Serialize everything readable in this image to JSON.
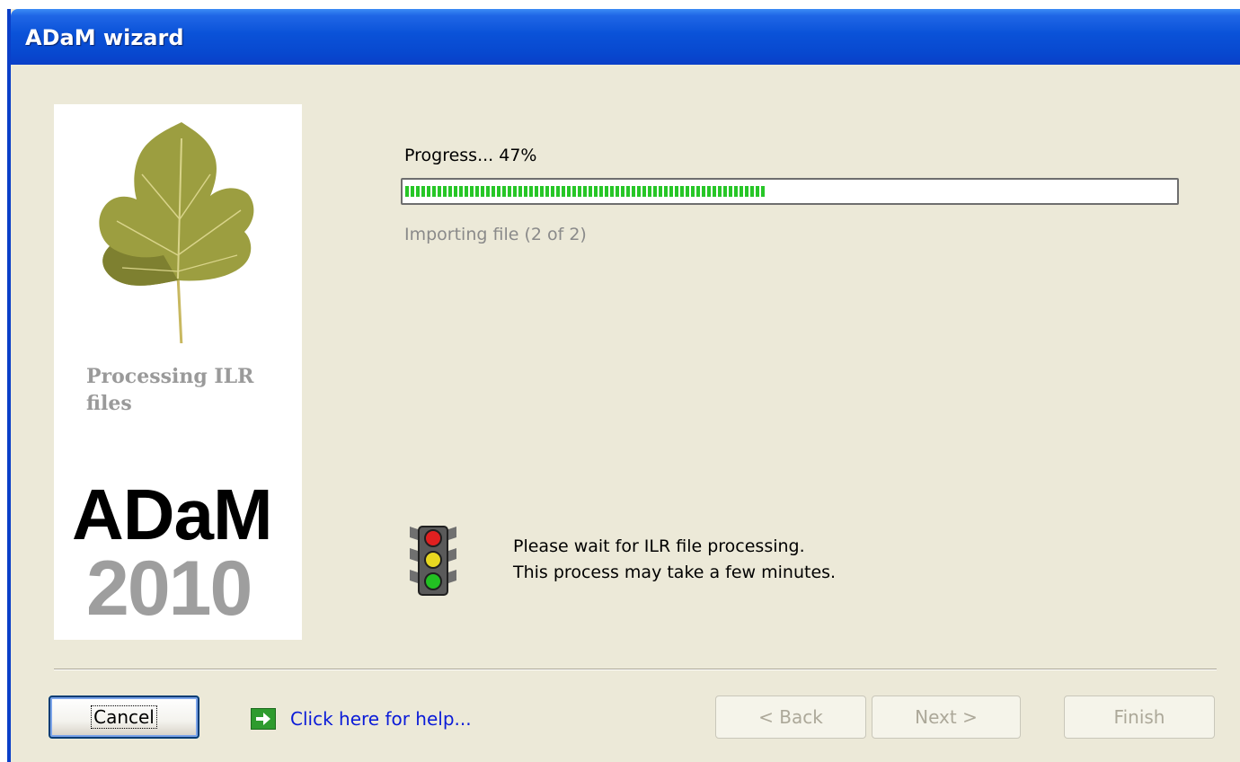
{
  "window": {
    "title": "ADaM wizard"
  },
  "side_panel": {
    "caption_line1": "Processing ILR",
    "caption_line2": "files",
    "logo_word": "ADaM",
    "logo_year": "2010"
  },
  "progress": {
    "label": "Progress...  47%",
    "value": 0.47,
    "status": "Importing file (2 of 2)"
  },
  "message": {
    "line1": "Please wait for ILR file processing.",
    "line2": "This process may take a few minutes."
  },
  "footer": {
    "cancel_label": "Cancel",
    "help_link": "Click here for help...",
    "back_label": "< Back",
    "next_label": "Next >",
    "finish_label": "Finish"
  },
  "colors": {
    "title_bar": "#0A52D8",
    "dialog_bg": "#ECE9D8",
    "progress_fill": "#27C627",
    "link": "#0A1BD8"
  },
  "icons": [
    "fig-leaf-icon",
    "traffic-light-icon",
    "arrow-right-icon"
  ]
}
